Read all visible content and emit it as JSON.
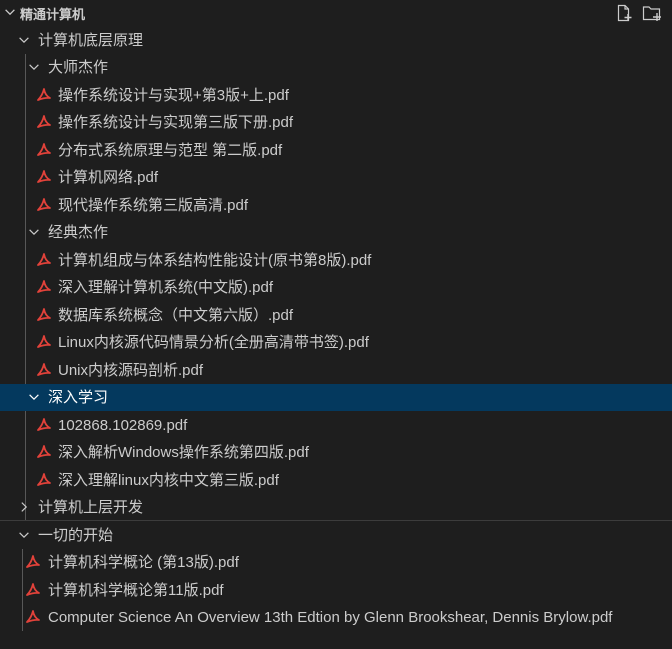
{
  "explorer": {
    "title": "精通计算机",
    "actions": [
      {
        "name": "new-file-icon"
      },
      {
        "name": "new-folder-icon"
      }
    ]
  },
  "tree": {
    "folder_1": {
      "label": "计算机底层原理",
      "expanded": true,
      "subfolder_1": {
        "label": "大师杰作",
        "files": [
          "操作系统设计与实现+第3版+上.pdf",
          "操作系统设计与实现第三版下册.pdf",
          "分布式系统原理与范型 第二版.pdf",
          "计算机网络.pdf",
          "现代操作系统第三版高清.pdf"
        ]
      },
      "subfolder_2": {
        "label": "经典杰作",
        "files": [
          "计算机组成与体系结构性能设计(原书第8版).pdf",
          "深入理解计算机系统(中文版).pdf",
          "数据库系统概念（中文第六版）.pdf",
          "Linux内核源代码情景分析(全册高清带书签).pdf",
          "Unix内核源码剖析.pdf"
        ]
      },
      "subfolder_3": {
        "label": "深入学习",
        "selected": true,
        "files": [
          "102868.102869.pdf",
          "深入解析Windows操作系统第四版.pdf",
          "深入理解linux内核中文第三版.pdf"
        ]
      }
    },
    "folder_2": {
      "label": "计算机上层开发",
      "expanded": false
    },
    "folder_3": {
      "label": "一切的开始",
      "expanded": true,
      "files": [
        "计算机科学概论 (第13版).pdf",
        "计算机科学概论第11版.pdf",
        "Computer Science An Overview 13th Edtion by Glenn Brookshear, Dennis Brylow.pdf"
      ]
    }
  },
  "colors": {
    "background": "#1e1e1e",
    "selected_row": "#04395e",
    "text": "#cccccc",
    "pdf_icon": "#e2423a",
    "indent_guide": "#585858"
  }
}
